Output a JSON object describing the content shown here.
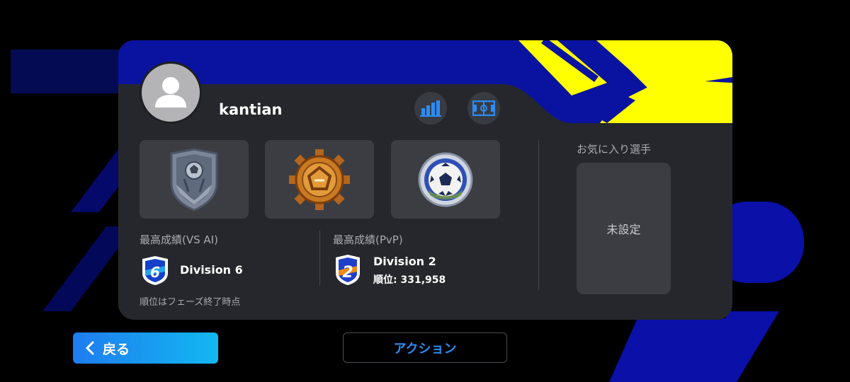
{
  "profile": {
    "username": "kantian",
    "avatar_icon": "person-silhouette-icon"
  },
  "header_buttons": [
    {
      "icon": "bar-chart-icon"
    },
    {
      "icon": "pitch-formation-icon"
    }
  ],
  "badges": [
    {
      "icon": "shield-trophy-badge-icon"
    },
    {
      "icon": "bronze-gear-badge-icon"
    },
    {
      "icon": "silver-ball-badge-icon"
    }
  ],
  "records": {
    "vs_ai": {
      "label": "最高成績(VS AI)",
      "division": "Division 6",
      "division_number": "6",
      "note": "順位はフェーズ終了時点"
    },
    "pvp": {
      "label": "最高成績(PvP)",
      "division": "Division 2",
      "division_number": "2",
      "rank": "順位: 331,958"
    }
  },
  "favorite": {
    "label": "お気に入り選手",
    "value": "未設定"
  },
  "buttons": {
    "back_label": "戻る",
    "action_label": "アクション"
  },
  "colors": {
    "accent_blue": "#2b8cf5",
    "banner_blue": "#0a13a0",
    "banner_yellow": "#ffff00",
    "card_bg": "#25272c"
  }
}
